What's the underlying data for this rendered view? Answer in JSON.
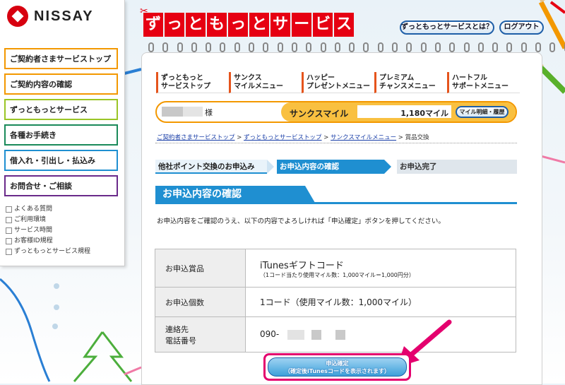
{
  "logo": {
    "text": "NISSAY"
  },
  "sidebar": {
    "items": [
      {
        "label": "ご契約者さまサービストップ",
        "color": "#f39800"
      },
      {
        "label": "ご契約内容の確認",
        "color": "#f39800"
      },
      {
        "label": "ずっともっとサービス",
        "color": "#9ac526"
      },
      {
        "label": "各種お手続き",
        "color": "#1a8a5a"
      },
      {
        "label": "借入れ・引出し・払込み",
        "color": "#1f8fd1"
      },
      {
        "label": "お問合せ・ご相談",
        "color": "#6a2a8a"
      }
    ],
    "links": [
      "よくある質問",
      "ご利用環境",
      "サービス時間",
      "お客様ID規程",
      "ずっともっとサービス規程"
    ]
  },
  "header": {
    "service_title_chars": [
      "ず",
      "っ",
      "と",
      "も",
      "っ",
      "と",
      "サ",
      "ー",
      "ビ",
      "ス"
    ],
    "about_button": "ずっともっとサービスとは？",
    "logout_button": "ログアウト"
  },
  "tabs": [
    {
      "label": "ずっともっと\nサービストップ"
    },
    {
      "label": "サンクス\nマイルメニュー"
    },
    {
      "label": "ハッピー\nプレゼントメニュー"
    },
    {
      "label": "プレミアム\nチャンスメニュー"
    },
    {
      "label": "ハートフル\nサポートメニュー"
    }
  ],
  "mile": {
    "honorific": "様",
    "label": "サンクスマイル",
    "value": "1,180マイル",
    "detail_button": "マイル明細・履歴"
  },
  "breadcrumb": {
    "items": [
      "ご契約者さまサービストップ",
      "ずっともっとサービストップ",
      "サンクスマイルメニュー"
    ],
    "current": "賞品交換",
    "sep": ">"
  },
  "steps": [
    {
      "label": "他社ポイント交換のお申込み"
    },
    {
      "label": "お申込内容の確認"
    },
    {
      "label": "お申込完了"
    }
  ],
  "section_title": "お申込内容の確認",
  "instruction": "お申込内容をご確認のうえ、以下の内容でよろしければ「申込確定」ボタンを押してください。",
  "details": {
    "product_label": "お申込賞品",
    "product_name": "iTunesギフトコード",
    "product_note": "（1コード当たり使用マイル数：1,000マイル＝1,000円分）",
    "qty_label": "お申込個数",
    "qty_value": "1コード（使用マイル数：1,000マイル）",
    "contact_label1": "連絡先",
    "contact_label2": "電話番号",
    "phone_prefix": "090-"
  },
  "submit": {
    "line1": "申込確定",
    "line2": "（確定後iTunesコードを表示されます）"
  },
  "colors": {
    "brand_red": "#e60012",
    "accent_blue": "#1f8fd1",
    "mile_orange": "#f9c040",
    "highlight_pink": "#e4006e"
  }
}
